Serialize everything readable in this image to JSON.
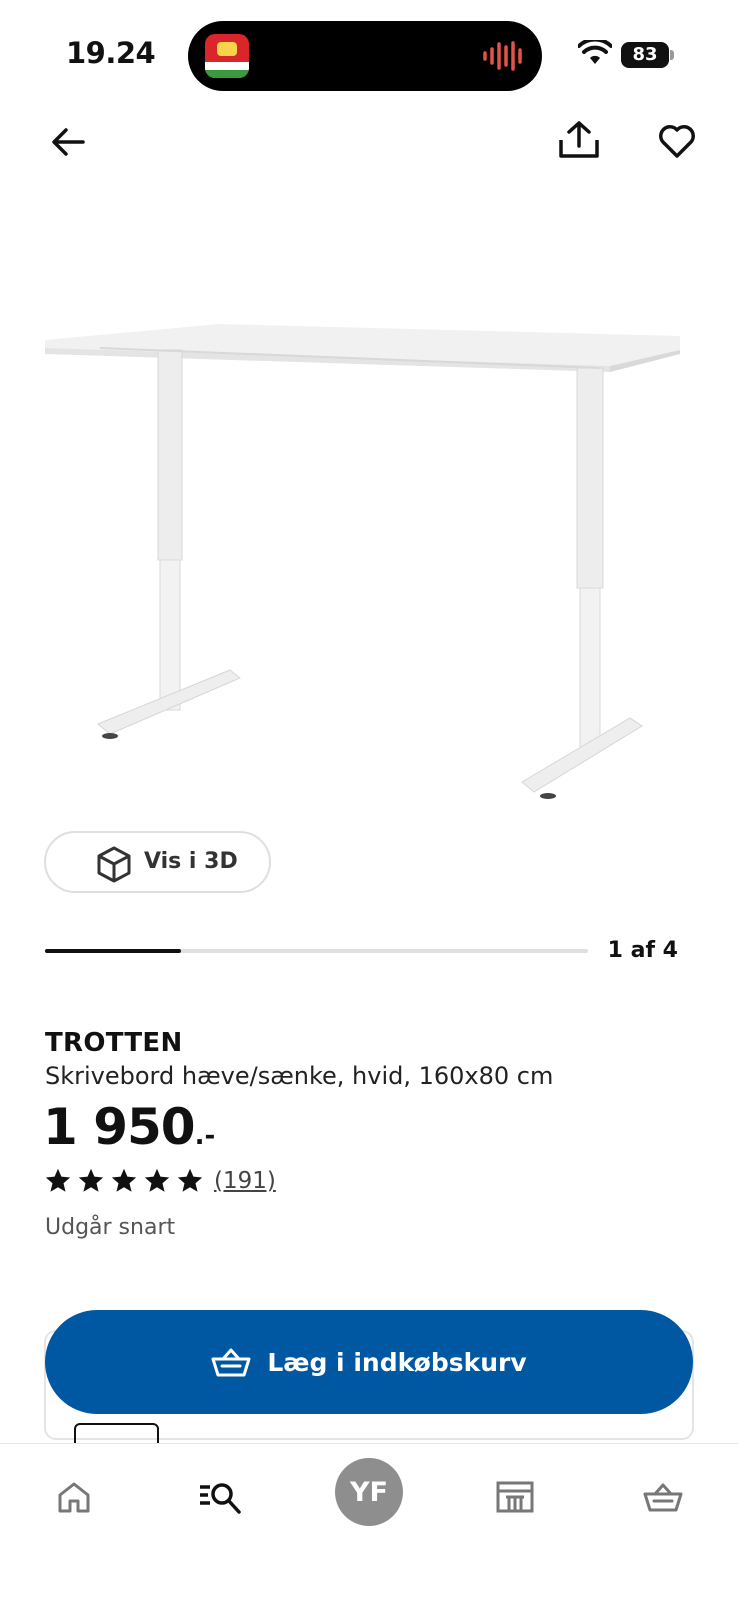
{
  "status_bar": {
    "time": "19.24",
    "battery": "83",
    "app_icon": "grocery-app-icon",
    "activity_icon": "audio-waveform-icon"
  },
  "top_nav": {
    "back_icon": "arrow-left-icon",
    "share_icon": "share-icon",
    "favorite_icon": "heart-icon"
  },
  "gallery": {
    "view_3d_label": "Vis i 3D",
    "page_indicator": "1 af 4",
    "current_index": 1,
    "total": 4
  },
  "product": {
    "brand": "TROTTEN",
    "description": "Skrivebord hæve/sænke, hvid, 160x80 cm",
    "price_main": "1 950",
    "price_suffix": ".-",
    "rating": 5,
    "review_count": "(191)",
    "stock_note": "Udgår snart"
  },
  "actions": {
    "add_to_cart_label": "Læg i indkøbskurv",
    "cart_icon": "basket-icon"
  },
  "tabbar": {
    "items": [
      {
        "name": "home",
        "icon": "home-icon"
      },
      {
        "name": "search",
        "icon": "search-list-icon"
      },
      {
        "name": "profile",
        "label": "YF"
      },
      {
        "name": "store",
        "icon": "store-icon"
      },
      {
        "name": "cart",
        "icon": "basket-icon"
      }
    ]
  },
  "colors": {
    "primary": "#0058a3",
    "text": "#111111",
    "avatar": "#8e8e8e"
  }
}
